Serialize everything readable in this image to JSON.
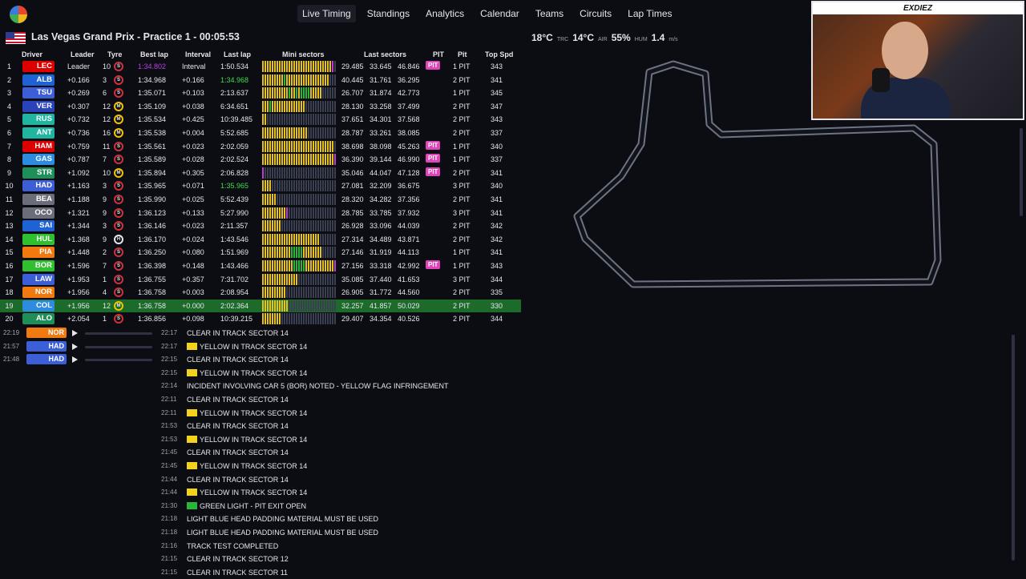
{
  "nav": {
    "items": [
      "Live Timing",
      "Standings",
      "Analytics",
      "Calendar",
      "Teams",
      "Circuits",
      "Lap Times"
    ],
    "active": "Live Timing"
  },
  "session": {
    "title": "Las Vegas Grand Prix - Practice 1 - 00:05:53",
    "track_temp": "18°C",
    "track_unit": "TRC",
    "air_temp": "14°C",
    "air_unit": "AIR",
    "humidity": "55%",
    "humidity_unit": "HUM",
    "wind": "1.4",
    "wind_unit": "m/s"
  },
  "headers": {
    "driver": "Driver",
    "leader": "Leader",
    "tyre": "Tyre",
    "best": "Best lap",
    "interval": "Interval",
    "last": "Last lap",
    "mini": "Mini sectors",
    "lastsec": "Last sectors",
    "pit": "PIT",
    "pitc": "Pit",
    "top": "Top Spd"
  },
  "rows": [
    {
      "pos": "1",
      "code": "LEC",
      "color": "#dc0000",
      "leader": "Leader",
      "age": "10",
      "tyre": "S",
      "best": "1:34.802",
      "interval": "Interval",
      "last": "1:50.534",
      "s1": "29.485",
      "s2": "33.645",
      "s3": "46.846",
      "pit": "PIT",
      "pits": "1 PIT",
      "spd": "343"
    },
    {
      "pos": "2",
      "code": "ALB",
      "color": "#1e63d6",
      "leader": "+0.166",
      "age": "3",
      "tyre": "S",
      "best": "1:34.968",
      "interval": "+0.166",
      "last": "1:34.968",
      "s1": "40.445",
      "s2": "31.761",
      "s3": "36.295",
      "pit": "",
      "pits": "2 PIT",
      "spd": "341"
    },
    {
      "pos": "3",
      "code": "TSU",
      "color": "#3c5ed6",
      "leader": "+0.269",
      "age": "6",
      "tyre": "S",
      "best": "1:35.071",
      "interval": "+0.103",
      "last": "2:13.637",
      "s1": "26.707",
      "s2": "31.874",
      "s3": "42.773",
      "pit": "",
      "pits": "1 PIT",
      "spd": "345"
    },
    {
      "pos": "4",
      "code": "VER",
      "color": "#2a43b8",
      "leader": "+0.307",
      "age": "12",
      "tyre": "M",
      "best": "1:35.109",
      "interval": "+0.038",
      "last": "6:34.651",
      "s1": "28.130",
      "s2": "33.258",
      "s3": "37.499",
      "pit": "",
      "pits": "2 PIT",
      "spd": "347"
    },
    {
      "pos": "5",
      "code": "RUS",
      "color": "#1fb5a0",
      "leader": "+0.732",
      "age": "12",
      "tyre": "M",
      "best": "1:35.534",
      "interval": "+0.425",
      "last": "10:39.485",
      "s1": "37.651",
      "s2": "34.301",
      "s3": "37.568",
      "pit": "",
      "pits": "2 PIT",
      "spd": "343"
    },
    {
      "pos": "6",
      "code": "ANT",
      "color": "#1fb5a0",
      "leader": "+0.736",
      "age": "16",
      "tyre": "M",
      "best": "1:35.538",
      "interval": "+0.004",
      "last": "5:52.685",
      "s1": "28.787",
      "s2": "33.261",
      "s3": "38.085",
      "pit": "",
      "pits": "2 PIT",
      "spd": "337"
    },
    {
      "pos": "7",
      "code": "HAM",
      "color": "#dc0000",
      "leader": "+0.759",
      "age": "11",
      "tyre": "S",
      "best": "1:35.561",
      "interval": "+0.023",
      "last": "2:02.059",
      "s1": "38.698",
      "s2": "38.098",
      "s3": "45.263",
      "pit": "PIT",
      "pits": "1 PIT",
      "spd": "340"
    },
    {
      "pos": "8",
      "code": "GAS",
      "color": "#2d8be0",
      "leader": "+0.787",
      "age": "7",
      "tyre": "S",
      "best": "1:35.589",
      "interval": "+0.028",
      "last": "2:02.524",
      "s1": "36.390",
      "s2": "39.144",
      "s3": "46.990",
      "pit": "PIT",
      "pits": "1 PIT",
      "spd": "337"
    },
    {
      "pos": "9",
      "code": "STR",
      "color": "#1f8f5a",
      "leader": "+1.092",
      "age": "10",
      "tyre": "M",
      "best": "1:35.894",
      "interval": "+0.305",
      "last": "2:06.828",
      "s1": "35.046",
      "s2": "44.047",
      "s3": "47.128",
      "pit": "PIT",
      "pits": "2 PIT",
      "spd": "341"
    },
    {
      "pos": "10",
      "code": "HAD",
      "color": "#3c5ed6",
      "leader": "+1.163",
      "age": "3",
      "tyre": "S",
      "best": "1:35.965",
      "interval": "+0.071",
      "last": "1:35.965",
      "s1": "27.081",
      "s2": "32.209",
      "s3": "36.675",
      "pit": "",
      "pits": "3 PIT",
      "spd": "340"
    },
    {
      "pos": "11",
      "code": "BEA",
      "color": "#6b6e7a",
      "leader": "+1.188",
      "age": "9",
      "tyre": "S",
      "best": "1:35.990",
      "interval": "+0.025",
      "last": "5:52.439",
      "s1": "28.320",
      "s2": "34.282",
      "s3": "37.356",
      "pit": "",
      "pits": "2 PIT",
      "spd": "341"
    },
    {
      "pos": "12",
      "code": "OCO",
      "color": "#6b6e7a",
      "leader": "+1.321",
      "age": "9",
      "tyre": "S",
      "best": "1:36.123",
      "interval": "+0.133",
      "last": "5:27.990",
      "s1": "28.785",
      "s2": "33.785",
      "s3": "37.932",
      "pit": "",
      "pits": "3 PIT",
      "spd": "341"
    },
    {
      "pos": "13",
      "code": "SAI",
      "color": "#1e63d6",
      "leader": "+1.344",
      "age": "3",
      "tyre": "S",
      "best": "1:36.146",
      "interval": "+0.023",
      "last": "2:11.357",
      "s1": "26.928",
      "s2": "33.096",
      "s3": "44.039",
      "pit": "",
      "pits": "2 PIT",
      "spd": "342"
    },
    {
      "pos": "14",
      "code": "HUL",
      "color": "#2fbf2f",
      "leader": "+1.368",
      "age": "9",
      "tyre": "H",
      "best": "1:36.170",
      "interval": "+0.024",
      "last": "1:43.546",
      "s1": "27.314",
      "s2": "34.489",
      "s3": "43.871",
      "pit": "",
      "pits": "2 PIT",
      "spd": "342"
    },
    {
      "pos": "15",
      "code": "PIA",
      "color": "#f07a10",
      "leader": "+1.448",
      "age": "2",
      "tyre": "S",
      "best": "1:36.250",
      "interval": "+0.080",
      "last": "1:51.969",
      "s1": "27.146",
      "s2": "31.919",
      "s3": "44.113",
      "pit": "",
      "pits": "1 PIT",
      "spd": "341"
    },
    {
      "pos": "16",
      "code": "BOR",
      "color": "#2fbf2f",
      "leader": "+1.596",
      "age": "7",
      "tyre": "S",
      "best": "1:36.398",
      "interval": "+0.148",
      "last": "1:43.466",
      "s1": "27.156",
      "s2": "33.318",
      "s3": "42.992",
      "pit": "PIT",
      "pits": "1 PIT",
      "spd": "343"
    },
    {
      "pos": "17",
      "code": "LAW",
      "color": "#3c5ed6",
      "leader": "+1.953",
      "age": "1",
      "tyre": "S",
      "best": "1:36.755",
      "interval": "+0.357",
      "last": "7:31.702",
      "s1": "35.085",
      "s2": "37.440",
      "s3": "41.653",
      "pit": "",
      "pits": "3 PIT",
      "spd": "344"
    },
    {
      "pos": "18",
      "code": "NOR",
      "color": "#f07a10",
      "leader": "+1.956",
      "age": "4",
      "tyre": "S",
      "best": "1:36.758",
      "interval": "+0.003",
      "last": "2:08.954",
      "s1": "26.905",
      "s2": "31.772",
      "s3": "44.560",
      "pit": "",
      "pits": "2 PIT",
      "spd": "335"
    },
    {
      "pos": "19",
      "code": "COL",
      "color": "#2d8be0",
      "leader": "+1.956",
      "age": "12",
      "tyre": "M",
      "best": "1:36.758",
      "interval": "+0.000",
      "last": "2:02.364",
      "s1": "32.257",
      "s2": "41.857",
      "s3": "50.029",
      "pit": "",
      "pits": "2 PIT",
      "spd": "330"
    },
    {
      "pos": "20",
      "code": "ALO",
      "color": "#1f8f5a",
      "leader": "+2.054",
      "age": "1",
      "tyre": "S",
      "best": "1:36.856",
      "interval": "+0.098",
      "last": "10:39.215",
      "s1": "29.407",
      "s2": "34.354",
      "s3": "40.526",
      "pit": "",
      "pits": "2 PIT",
      "spd": "344"
    }
  ],
  "radios": [
    {
      "time": "22:19",
      "code": "NOR",
      "color": "#f07a10"
    },
    {
      "time": "21:57",
      "code": "HAD",
      "color": "#3c5ed6"
    },
    {
      "time": "21:48",
      "code": "HAD",
      "color": "#3c5ed6"
    }
  ],
  "messages": [
    {
      "time": "22:17",
      "text": "CLEAR IN TRACK SECTOR 14",
      "flag": ""
    },
    {
      "time": "22:17",
      "text": "YELLOW IN TRACK SECTOR 14",
      "flag": "#f2d21c"
    },
    {
      "time": "22:15",
      "text": "CLEAR IN TRACK SECTOR 14",
      "flag": ""
    },
    {
      "time": "22:15",
      "text": "YELLOW IN TRACK SECTOR 14",
      "flag": "#f2d21c"
    },
    {
      "time": "22:14",
      "text": "INCIDENT INVOLVING CAR 5 (BOR) NOTED - YELLOW FLAG INFRINGEMENT",
      "flag": ""
    },
    {
      "time": "22:11",
      "text": "CLEAR IN TRACK SECTOR 14",
      "flag": ""
    },
    {
      "time": "22:11",
      "text": "YELLOW IN TRACK SECTOR 14",
      "flag": "#f2d21c"
    },
    {
      "time": "21:53",
      "text": "CLEAR IN TRACK SECTOR 14",
      "flag": ""
    },
    {
      "time": "21:53",
      "text": "YELLOW IN TRACK SECTOR 14",
      "flag": "#f2d21c"
    },
    {
      "time": "21:45",
      "text": "CLEAR IN TRACK SECTOR 14",
      "flag": ""
    },
    {
      "time": "21:45",
      "text": "YELLOW IN TRACK SECTOR 14",
      "flag": "#f2d21c"
    },
    {
      "time": "21:44",
      "text": "CLEAR IN TRACK SECTOR 14",
      "flag": ""
    },
    {
      "time": "21:44",
      "text": "YELLOW IN TRACK SECTOR 14",
      "flag": "#f2d21c"
    },
    {
      "time": "21:30",
      "text": "GREEN LIGHT - PIT EXIT OPEN",
      "flag": "#27b53a"
    },
    {
      "time": "21:18",
      "text": "LIGHT BLUE HEAD PADDING MATERIAL MUST BE USED",
      "flag": ""
    },
    {
      "time": "21:18",
      "text": "LIGHT BLUE HEAD PADDING MATERIAL MUST BE USED",
      "flag": ""
    },
    {
      "time": "21:16",
      "text": "TRACK TEST COMPLETED",
      "flag": ""
    },
    {
      "time": "21:15",
      "text": "CLEAR IN TRACK SECTOR 12",
      "flag": ""
    },
    {
      "time": "21:15",
      "text": "CLEAR IN TRACK SECTOR 11",
      "flag": ""
    }
  ],
  "webcam": {
    "name": "EXDIEZ"
  }
}
